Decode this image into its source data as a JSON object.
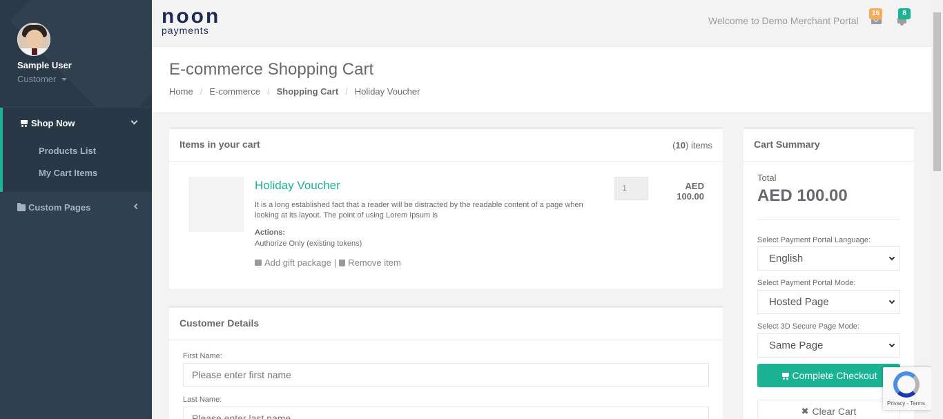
{
  "brand": {
    "name": "noon",
    "subname": "payments"
  },
  "user": {
    "name": "Sample User",
    "role": "Customer"
  },
  "sidebar": {
    "shop_now": "Shop Now",
    "items": [
      {
        "label": "Products List"
      },
      {
        "label": "My Cart Items"
      }
    ],
    "custom_pages": "Custom Pages"
  },
  "topbar": {
    "welcome": "Welcome to Demo Merchant Portal",
    "messages_count": "16",
    "notifications_count": "8"
  },
  "page": {
    "title": "E-commerce Shopping Cart",
    "breadcrumb": [
      "Home",
      "E-commerce",
      "Shopping Cart",
      "Holiday Voucher"
    ]
  },
  "cart": {
    "header": "Items in your cart",
    "count_open": "(",
    "count": "10",
    "count_close": ")",
    "count_suffix": "items",
    "item": {
      "name": "Holiday Voucher",
      "description": "It is a long established fact that a reader will be distracted by the readable content of a page when looking at its layout. The point of using Lorem Ipsum is",
      "actions_label": "Actions:",
      "actions_value": "Authorize Only (existing tokens)",
      "add_gift": "Add gift package",
      "separator": "|",
      "remove": "Remove item",
      "quantity": "1",
      "currency": "AED",
      "price": "100.00"
    }
  },
  "customer": {
    "header": "Customer Details",
    "first_name_label": "First Name:",
    "first_name_placeholder": "Please enter first name",
    "last_name_label": "Last Name:",
    "last_name_placeholder": "Please enter last name"
  },
  "summary": {
    "header": "Cart Summary",
    "total_label": "Total",
    "total_value": "AED 100.00",
    "language_label": "Select Payment Portal Language:",
    "language_value": "English",
    "mode_label": "Select Payment Portal Mode:",
    "mode_value": "Hosted Page",
    "secure_label": "Select 3D Secure Page Mode:",
    "secure_value": "Same Page",
    "checkout_label": "Complete Checkout",
    "clear_label": "Clear Cart"
  },
  "recaptcha": {
    "text": "Privacy - Terms"
  },
  "colors": {
    "accent": "#1ab394",
    "sidebar": "#2f4050",
    "warning": "#f8ac59",
    "brand": "#1b2a52"
  }
}
